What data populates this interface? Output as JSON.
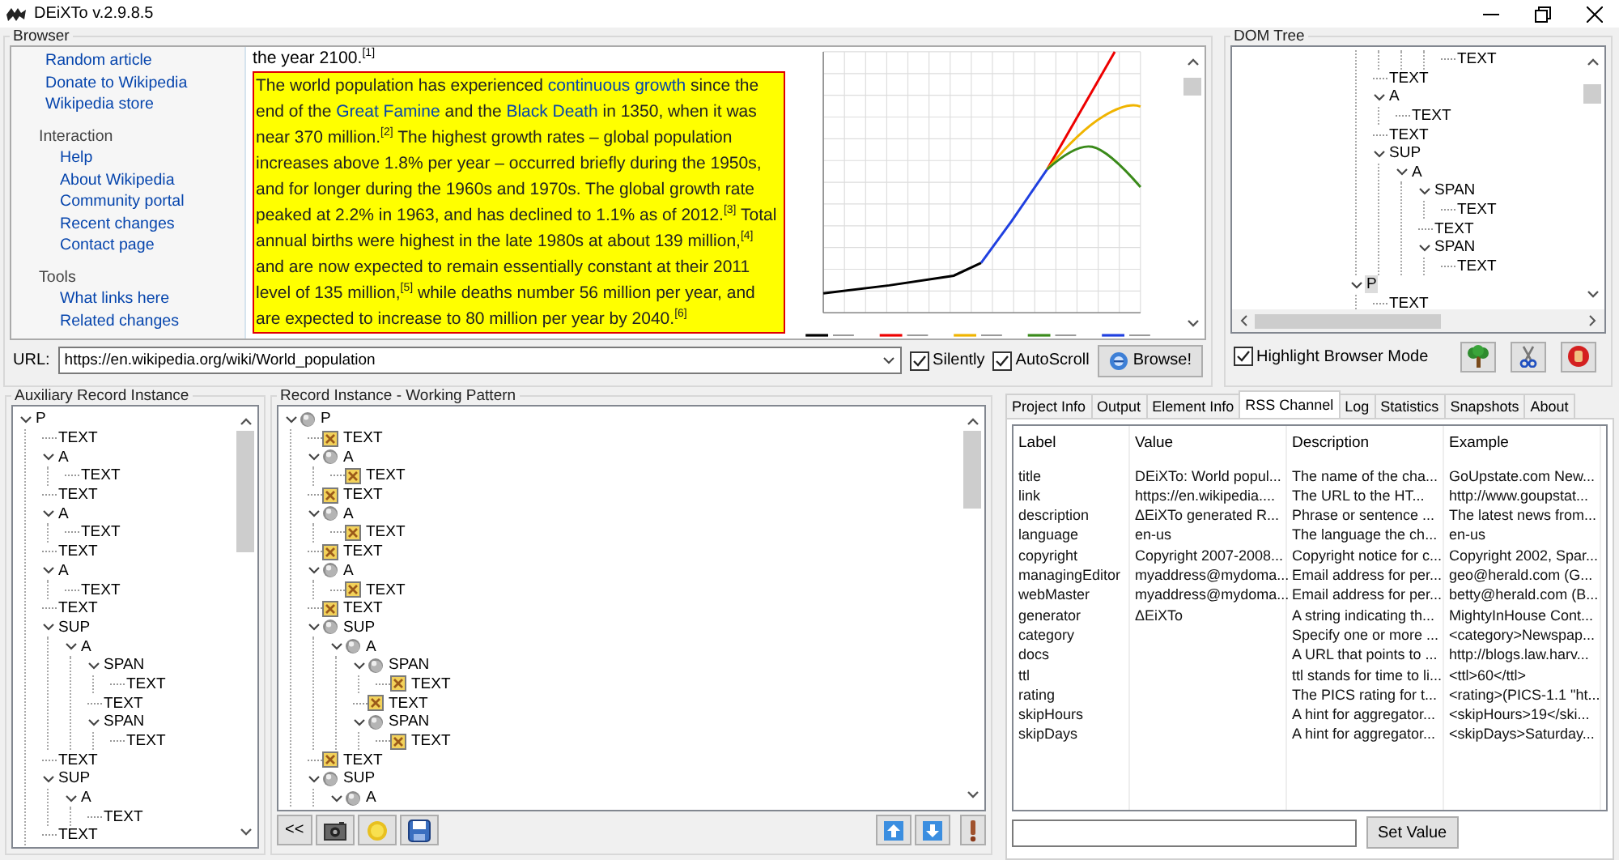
{
  "window": {
    "title": "DEiXTo v.2.9.8.5"
  },
  "browser": {
    "title": "Browser",
    "sidebar": [
      {
        "links": [
          "Random article",
          "Donate to Wikipedia",
          "Wikipedia store"
        ]
      },
      {
        "heading": "Interaction",
        "links": [
          "Help",
          "About Wikipedia",
          "Community portal",
          "Recent changes",
          "Contact page"
        ]
      },
      {
        "heading": "Tools",
        "links": [
          "What links here",
          "Related changes"
        ]
      }
    ],
    "article_intro": "the year 2100.$^{[1]}$",
    "paragraph": {
      "highlighted": true,
      "segments": [
        {
          "kind": "text",
          "text": "The world population has experienced "
        },
        {
          "kind": "link",
          "text": "continuous growth"
        },
        {
          "kind": "text",
          "text": " since the end of the "
        },
        {
          "kind": "link",
          "text": "Great Famine"
        },
        {
          "kind": "text",
          "text": " and the "
        },
        {
          "kind": "link",
          "text": "Black Death"
        },
        {
          "kind": "text",
          "text": " in 1350, when it was near 370 million.$^{[2]}$ The highest growth rates – global population increases above 1.8% per year – occurred briefly during the 1950s, and for longer during the 1960s and 1970s. The global growth rate peaked at 2.2% in 1963, and has declined to 1.1% as of 2012.$^{[3]}$ Total annual births were highest in the late 1980s at about 139 million,$^{[4]}$ and are now expected to remain essentially constant at their 2011 level of 135 million,$^{[5]}$ while deaths number 56 million per year, and are expected to increase to 80 million per year by 2040.$^{[6]}$"
        }
      ]
    },
    "url_label": "URL:",
    "url": "https://en.wikipedia.org/wiki/World_population",
    "options": [
      {
        "label": "Silently",
        "checked": true
      },
      {
        "label": "AutoScroll",
        "checked": true
      }
    ],
    "browse_button": "Browse!"
  },
  "dom_tree": {
    "title": "DOM Tree",
    "nodes": [
      {
        "children": [
          {
            "children": [
              {
                "children": [
                  {
                    "children": [
                      {
                        "label": "TEXT",
                        "selected": false
                      }
                    ]
                  }
                ]
              }
            ]
          },
          {
            "label": "TEXT",
            "selected": false
          },
          {
            "label": "A",
            "selected": false,
            "expanded": true,
            "children": [
              {
                "label": "TEXT",
                "selected": false
              }
            ]
          },
          {
            "label": "TEXT",
            "selected": false
          },
          {
            "label": "SUP",
            "selected": false,
            "expanded": true,
            "children": [
              {
                "label": "A",
                "selected": false,
                "expanded": true,
                "children": [
                  {
                    "label": "SPAN",
                    "selected": false,
                    "expanded": true,
                    "children": [
                      {
                        "label": "TEXT",
                        "selected": false
                      }
                    ]
                  },
                  {
                    "label": "TEXT",
                    "selected": false
                  },
                  {
                    "label": "SPAN",
                    "selected": false,
                    "expanded": true,
                    "children": [
                      {
                        "label": "TEXT",
                        "selected": false
                      }
                    ]
                  }
                ]
              }
            ]
          }
        ]
      },
      {
        "label": "P",
        "selected": true,
        "expanded": true,
        "children": [
          {
            "label": "TEXT",
            "selected": false
          }
        ]
      }
    ],
    "highlight_mode": {
      "label": "Highlight Browser Mode",
      "checked": true
    }
  },
  "auxiliary": {
    "title": "Auxiliary Record Instance",
    "nodes": [
      {
        "label": "P",
        "expanded": true,
        "children": [
          {
            "label": "TEXT"
          },
          {
            "label": "A",
            "expanded": true,
            "children": [
              {
                "label": "TEXT"
              }
            ]
          },
          {
            "label": "TEXT"
          },
          {
            "label": "A",
            "expanded": true,
            "children": [
              {
                "label": "TEXT"
              }
            ]
          },
          {
            "label": "TEXT"
          },
          {
            "label": "A",
            "expanded": true,
            "children": [
              {
                "label": "TEXT"
              }
            ]
          },
          {
            "label": "TEXT"
          },
          {
            "label": "SUP",
            "expanded": true,
            "children": [
              {
                "label": "A",
                "expanded": true,
                "children": [
                  {
                    "label": "SPAN",
                    "expanded": true,
                    "children": [
                      {
                        "label": "TEXT"
                      }
                    ]
                  },
                  {
                    "label": "TEXT"
                  },
                  {
                    "label": "SPAN",
                    "expanded": true,
                    "children": [
                      {
                        "label": "TEXT"
                      }
                    ]
                  }
                ]
              }
            ]
          },
          {
            "label": "TEXT"
          },
          {
            "label": "SUP",
            "expanded": true,
            "children": [
              {
                "label": "A",
                "expanded": true,
                "children": [
                  {
                    "label": "TEXT"
                  }
                ]
              }
            ]
          },
          {
            "label": "TEXT"
          }
        ]
      }
    ]
  },
  "working_pattern": {
    "title": "Record Instance - Working Pattern",
    "back_button": "<<",
    "nodes": [
      {
        "label": "P",
        "kind": "element",
        "expanded": true,
        "children": [
          {
            "label": "TEXT",
            "kind": "text"
          },
          {
            "label": "A",
            "kind": "element",
            "expanded": true,
            "children": [
              {
                "label": "TEXT",
                "kind": "text"
              }
            ]
          },
          {
            "label": "TEXT",
            "kind": "text"
          },
          {
            "label": "A",
            "kind": "element",
            "expanded": true,
            "children": [
              {
                "label": "TEXT",
                "kind": "text"
              }
            ]
          },
          {
            "label": "TEXT",
            "kind": "text"
          },
          {
            "label": "A",
            "kind": "element",
            "expanded": true,
            "children": [
              {
                "label": "TEXT",
                "kind": "text"
              }
            ]
          },
          {
            "label": "TEXT",
            "kind": "text"
          },
          {
            "label": "SUP",
            "kind": "element",
            "expanded": true,
            "children": [
              {
                "label": "A",
                "kind": "element",
                "expanded": true,
                "children": [
                  {
                    "label": "SPAN",
                    "kind": "element",
                    "expanded": true,
                    "children": [
                      {
                        "label": "TEXT",
                        "kind": "text"
                      }
                    ]
                  },
                  {
                    "label": "TEXT",
                    "kind": "text"
                  },
                  {
                    "label": "SPAN",
                    "kind": "element",
                    "expanded": true,
                    "children": [
                      {
                        "label": "TEXT",
                        "kind": "text"
                      }
                    ]
                  }
                ]
              }
            ]
          },
          {
            "label": "TEXT",
            "kind": "text"
          },
          {
            "label": "SUP",
            "kind": "element",
            "expanded": true,
            "children": [
              {
                "label": "A",
                "kind": "element",
                "expanded": true
              }
            ]
          }
        ]
      }
    ]
  },
  "tabs": [
    {
      "label": "Project Info",
      "selected": false
    },
    {
      "label": "Output",
      "selected": false
    },
    {
      "label": "Element Info",
      "selected": false
    },
    {
      "label": "RSS Channel",
      "selected": true
    },
    {
      "label": "Log",
      "selected": false
    },
    {
      "label": "Statistics",
      "selected": false
    },
    {
      "label": "Snapshots",
      "selected": false
    },
    {
      "label": "About",
      "selected": false
    }
  ],
  "rss_table": {
    "columns": [
      "Label",
      "Value",
      "Description",
      "Example"
    ],
    "rows": [
      {
        "label": "title",
        "value": "DEiXTo: World popul...",
        "description": "The name of the cha...",
        "example": "GoUpstate.com New..."
      },
      {
        "label": "link",
        "value": "https://en.wikipedia....",
        "description": "The URL to the HT...",
        "example": "http://www.goupstat..."
      },
      {
        "label": "description",
        "value": "ΔEiXTo generated R...",
        "description": "Phrase or sentence ...",
        "example": "The latest news from..."
      },
      {
        "label": "language",
        "value": "en-us",
        "description": "The language the ch...",
        "example": "en-us"
      },
      {
        "label": "copyright",
        "value": "Copyright 2007-2008...",
        "description": "Copyright notice for c...",
        "example": "Copyright 2002, Spar..."
      },
      {
        "label": "managingEditor",
        "value": "myaddress@mydoma...",
        "description": "Email address for per...",
        "example": "geo@herald.com (G..."
      },
      {
        "label": "webMaster",
        "value": "myaddress@mydoma...",
        "description": "Email address for per...",
        "example": "betty@herald.com (B..."
      },
      {
        "label": "generator",
        "value": "ΔEiXTo",
        "description": "A string indicating th...",
        "example": "MightyInHouse Cont..."
      },
      {
        "label": "category",
        "description": "Specify one or more ...",
        "example": "<category>Newspap..."
      },
      {
        "label": "docs",
        "description": "A URL that points to ...",
        "example": "http://blogs.law.harv..."
      },
      {
        "label": "ttl",
        "description": "ttl stands for time to li...",
        "example": "<ttl>60</ttl>"
      },
      {
        "label": "rating",
        "description": "The PICS rating for t...",
        "example": "<rating>(PICS-1.1 \"ht..."
      },
      {
        "label": "skipHours",
        "description": "A hint for aggregator...",
        "example": "<skipHours>19</ski..."
      },
      {
        "label": "skipDays",
        "description": "A hint for aggregator...",
        "example": "<skipDays>Saturday..."
      }
    ]
  },
  "set_value_button": "Set Value"
}
